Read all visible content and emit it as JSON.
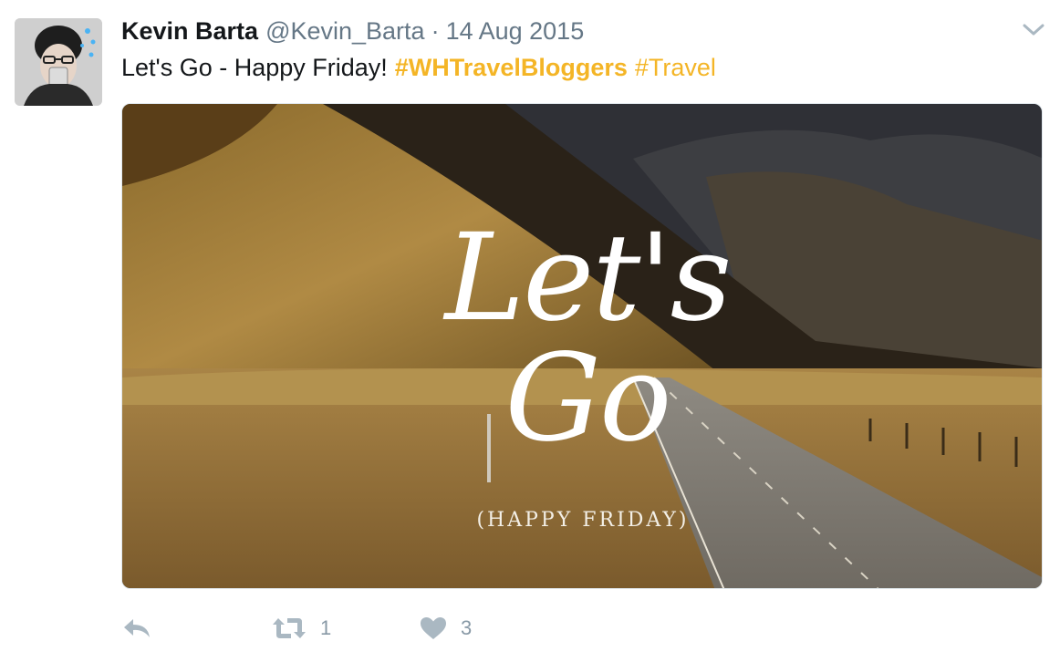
{
  "tweet": {
    "author_name": "Kevin Barta",
    "author_handle": "@Kevin_Barta",
    "separator": "·",
    "date": "14 Aug 2015",
    "text": "Let's Go - Happy Friday!",
    "hashtags": [
      "#WHTravelBloggers",
      "#Travel"
    ],
    "media": {
      "headline": "Let's Go",
      "subline": "(HAPPY FRIDAY)"
    },
    "actions": {
      "retweet_count": "1",
      "like_count": "3"
    }
  },
  "icons": {
    "menu": "chevron-down-icon",
    "reply": "reply-icon",
    "retweet": "retweet-icon",
    "like": "heart-icon"
  },
  "colors": {
    "hashtag": "#f4b526",
    "secondary": "#657786",
    "action": "#8899a6"
  }
}
